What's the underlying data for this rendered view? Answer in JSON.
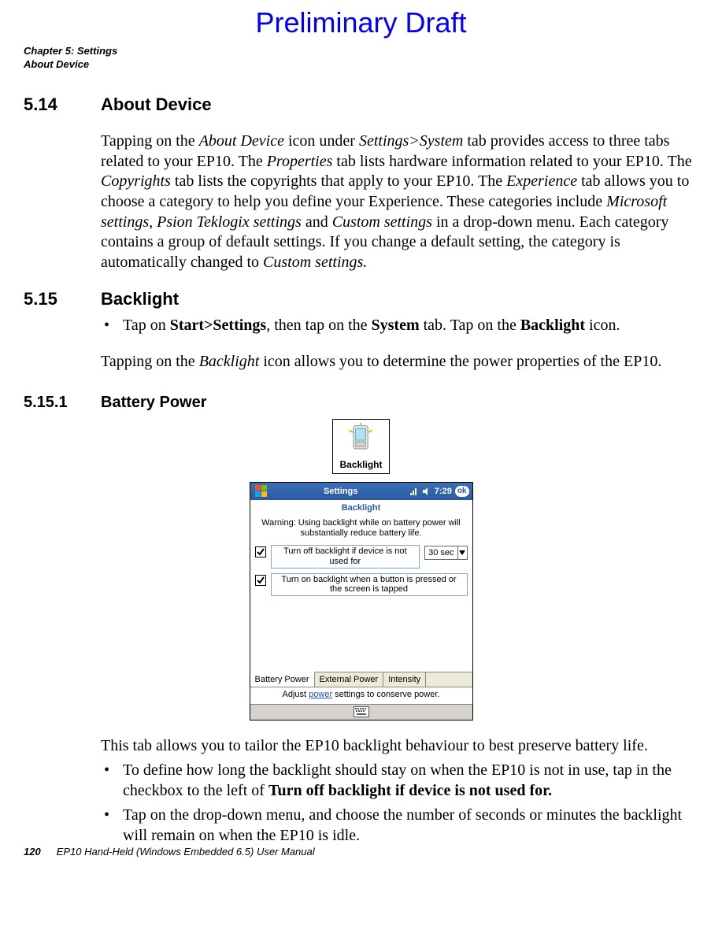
{
  "watermark": "Preliminary Draft",
  "running_head": {
    "chapter": "Chapter 5: Settings",
    "section": "About Device"
  },
  "s514": {
    "num": "5.14",
    "title": "About Device",
    "text_parts": [
      "Tapping on the ",
      "About Device",
      " icon under ",
      "Settings>System",
      " tab provides access to three tabs related to your EP10. The ",
      "Properties",
      " tab lists hardware information related to your EP10. The ",
      "Copyrights",
      " tab lists the copyrights that apply to your EP10. The ",
      "Experience",
      " tab allows you to choose a category to help you define your Experience. These categories include ",
      "Microsoft settings",
      ", ",
      "Psion Teklogix settings",
      " and ",
      "Custom settings",
      " in a drop-down menu. Each category contains a group of default settings. If you change a default setting, the category is automatically changed to ",
      "Custom settings."
    ]
  },
  "s515": {
    "num": "5.15",
    "title": "Backlight",
    "bullet_parts": [
      "Tap on ",
      "Start>Settings",
      ", then tap on the ",
      "System",
      " tab. Tap on the ",
      "Backlight",
      " icon."
    ],
    "para_parts": [
      "Tapping on the ",
      "Backlight",
      " icon allows you to determine the power properties of the EP10."
    ]
  },
  "s5151": {
    "num": "5.15.1",
    "title": "Battery Power",
    "icon_label": "Backlight",
    "device": {
      "title": "Settings",
      "time": "7:29",
      "ok": "ok",
      "subtitle": "Backlight",
      "warning": "Warning: Using backlight while on battery power will substantially reduce battery life.",
      "opt1": "Turn off backlight if device is not used for",
      "dd_value": "30 sec",
      "opt2": "Turn on backlight when a button is pressed or the screen is tapped",
      "tabs": [
        "Battery Power",
        "External Power",
        "Intensity"
      ],
      "adjust_pre": "Adjust ",
      "adjust_link": "power",
      "adjust_post": " settings to conserve power."
    },
    "after_para": "This tab allows you to tailor the EP10 backlight behaviour to best preserve battery life.",
    "bullets": [
      {
        "pre": "To define how long the backlight should stay on when the EP10 is not in use, tap in the checkbox to the left of ",
        "bold": "Turn off backlight if device is not used for."
      },
      {
        "pre": "Tap on the drop-down menu, and choose the number of seconds or minutes the backlight will remain on when the EP10 is idle.",
        "bold": ""
      }
    ]
  },
  "footer": {
    "page": "120",
    "title": "EP10 Hand-Held (Windows Embedded 6.5) User Manual"
  }
}
